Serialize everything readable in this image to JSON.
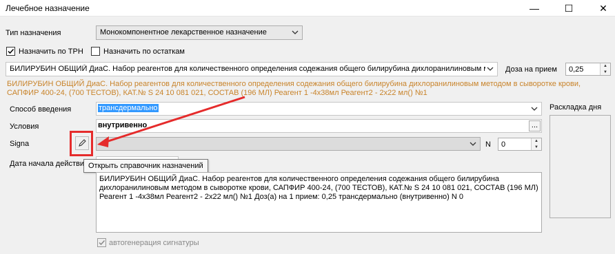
{
  "window": {
    "title": "Лечебное назначение",
    "minimize": "—",
    "maximize": "☐",
    "close": "✕"
  },
  "form": {
    "type_label": "Тип назначения",
    "type_value": "Монокомпонентное лекарственное назначение",
    "assign_trn_label": "Назначить по ТРН",
    "assign_trn_checked": true,
    "assign_stock_label": "Назначить по остаткам",
    "assign_stock_checked": false,
    "drug_value": "БИЛИРУБИН ОБЩИЙ ДиаС. Набор реагентов для количественного определения содежания общего билирубина дихлоранилиновым мет",
    "dose_label": "Доза на прием",
    "dose_value": "0,25",
    "drug_description_line1": "БИЛИРУБИН ОБЩИЙ ДиаС. Набор реагентов для количественного определения содежания общего билирубина дихлоранилиновым методом в сыворотке крови,",
    "drug_description_line2": "САПФИР 400-24, (700 ТЕСТОВ), КАТ.№ S 24 10 081 021, СОСТАВ (196 МЛ) Реагент 1 -4х38мл Реагент2 - 2х22 мл()    №1",
    "route_label": "Способ введения",
    "route_value": "трансдермально",
    "conditions_label": "Условия",
    "conditions_value": "внутривенно",
    "conditions_button": "...",
    "signa_label": "Signa",
    "signa_value": "",
    "n_label": "N",
    "n_value": "0",
    "start_date_label": "Дата начала действия",
    "tooltip": "Открыть справочник назначений",
    "summary_line1": "БИЛИРУБИН ОБЩИЙ ДиаС. Набор реагентов для количественного определения содежания общего билирубина",
    "summary_line2": "дихлоранилиновым методом в сыворотке крови, САПФИР 400-24, (700 ТЕСТОВ), КАТ.№ S 24 10 081 021, СОСТАВ (196 МЛ)",
    "summary_line3": "Реагент 1 -4х38мл Реагент2 - 2х22 мл()    №1 Доз(а) на 1 прием: 0,25  трансдермально (внутривенно)  N 0",
    "autogen_label": "автогенерация сигнатуры",
    "autogen_checked": true,
    "day_layout_label": "Раскладка дня"
  },
  "colors": {
    "accent_orange": "#c8832a",
    "selection_blue": "#3399ff",
    "annotation_red": "#e52b2b"
  }
}
